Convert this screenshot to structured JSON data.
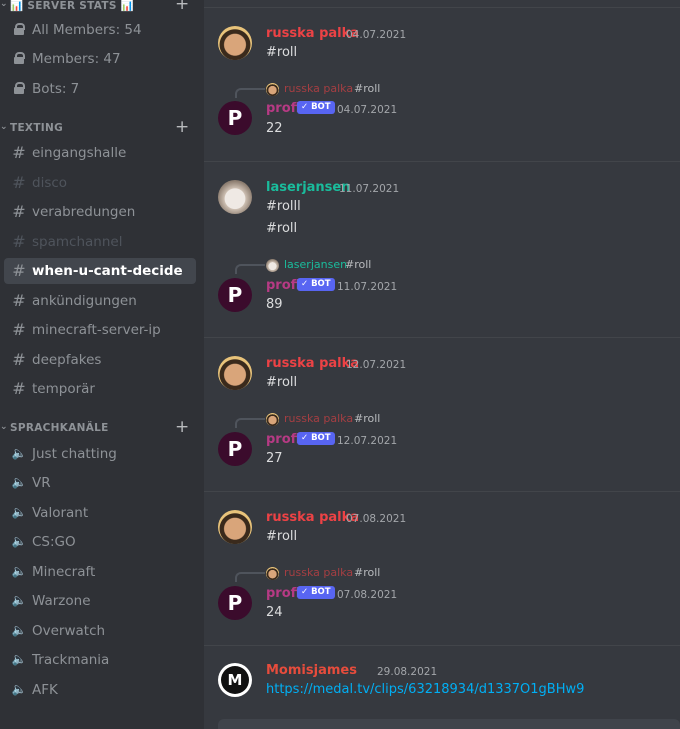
{
  "sidebar": {
    "categories": [
      {
        "name": "📊 SERVER STATS 📊",
        "chevron": "⌄",
        "plus": "+"
      },
      {
        "name": "TEXTING",
        "chevron": "⌄",
        "plus": "+"
      },
      {
        "name": "SPRACHKANÄLE",
        "chevron": "⌄",
        "plus": "+"
      }
    ],
    "stats": [
      {
        "label": "All Members: 54",
        "icon": "lock-icon"
      },
      {
        "label": "Members: 47",
        "icon": "lock-icon"
      },
      {
        "label": "Bots: 7",
        "icon": "lock-icon"
      }
    ],
    "text_channels": [
      {
        "label": "eingangshalle",
        "icon": "#"
      },
      {
        "label": "disco",
        "icon": "#"
      },
      {
        "label": "verabredungen",
        "icon": "#"
      },
      {
        "label": "spamchannel",
        "icon": "#"
      },
      {
        "label": "when-u-cant-decide",
        "icon": "#"
      },
      {
        "label": "ankündigungen",
        "icon": "#"
      },
      {
        "label": "minecraft-server-ip",
        "icon": "#"
      },
      {
        "label": "deepfakes",
        "icon": "#"
      },
      {
        "label": "temporär",
        "icon": "#"
      }
    ],
    "voice_channels": [
      {
        "label": "Just chatting",
        "icon": "🔈"
      },
      {
        "label": "VR",
        "icon": "🔈"
      },
      {
        "label": "Valorant",
        "icon": "🔈"
      },
      {
        "label": "CS:GO",
        "icon": "🔈"
      },
      {
        "label": "Minecraft",
        "icon": "🔈"
      },
      {
        "label": "Warzone",
        "icon": "🔈"
      },
      {
        "label": "Overwatch",
        "icon": "🔈"
      },
      {
        "label": "Trackmania",
        "icon": "🔈"
      },
      {
        "label": "AFK",
        "icon": "🔈"
      }
    ]
  },
  "messages": {
    "g1": {
      "author": "russka palka",
      "time": "04.07.2021",
      "lines": [
        "#roll"
      ]
    },
    "r1": {
      "reply_author": "russka palka",
      "reply_text": "#roll",
      "author": "profi",
      "bot_label": "✓ BOT",
      "time": "04.07.2021",
      "lines": [
        "22"
      ]
    },
    "g2": {
      "author": "laserjansen",
      "time": "11.07.2021",
      "lines": [
        "#rolll",
        "#roll"
      ]
    },
    "r2": {
      "reply_author": "laserjansen",
      "reply_text": "#roll",
      "author": "profi",
      "bot_label": "✓ BOT",
      "time": "11.07.2021",
      "lines": [
        "89"
      ]
    },
    "g3": {
      "author": "russka palka",
      "time": "12.07.2021",
      "lines": [
        "#roll"
      ]
    },
    "r3": {
      "reply_author": "russka palka",
      "reply_text": "#roll",
      "author": "profi",
      "bot_label": "✓ BOT",
      "time": "12.07.2021",
      "lines": [
        "27"
      ]
    },
    "g4": {
      "author": "russka palka",
      "time": "07.08.2021",
      "lines": [
        "#roll"
      ]
    },
    "r4": {
      "reply_author": "russka palka",
      "reply_text": "#roll",
      "author": "profi",
      "bot_label": "✓ BOT",
      "time": "07.08.2021",
      "lines": [
        "24"
      ]
    },
    "g5": {
      "author": "Momisjames",
      "time": "29.08.2021",
      "lines": [
        "https://medal.tv/clips/63218934/d1337O1gBHw9"
      ]
    }
  },
  "icons": {
    "profi_avatar_glyph": "P",
    "momis_avatar_glyph": "M"
  },
  "colors": {
    "sidebar_bg": "#2f3136",
    "main_bg": "#36393f",
    "russka": "#ed4245",
    "laser": "#1abc9c",
    "profi": "#b63a84",
    "momis": "#e74c3c",
    "bot_badge": "#5865f2",
    "link": "#00aff4"
  }
}
